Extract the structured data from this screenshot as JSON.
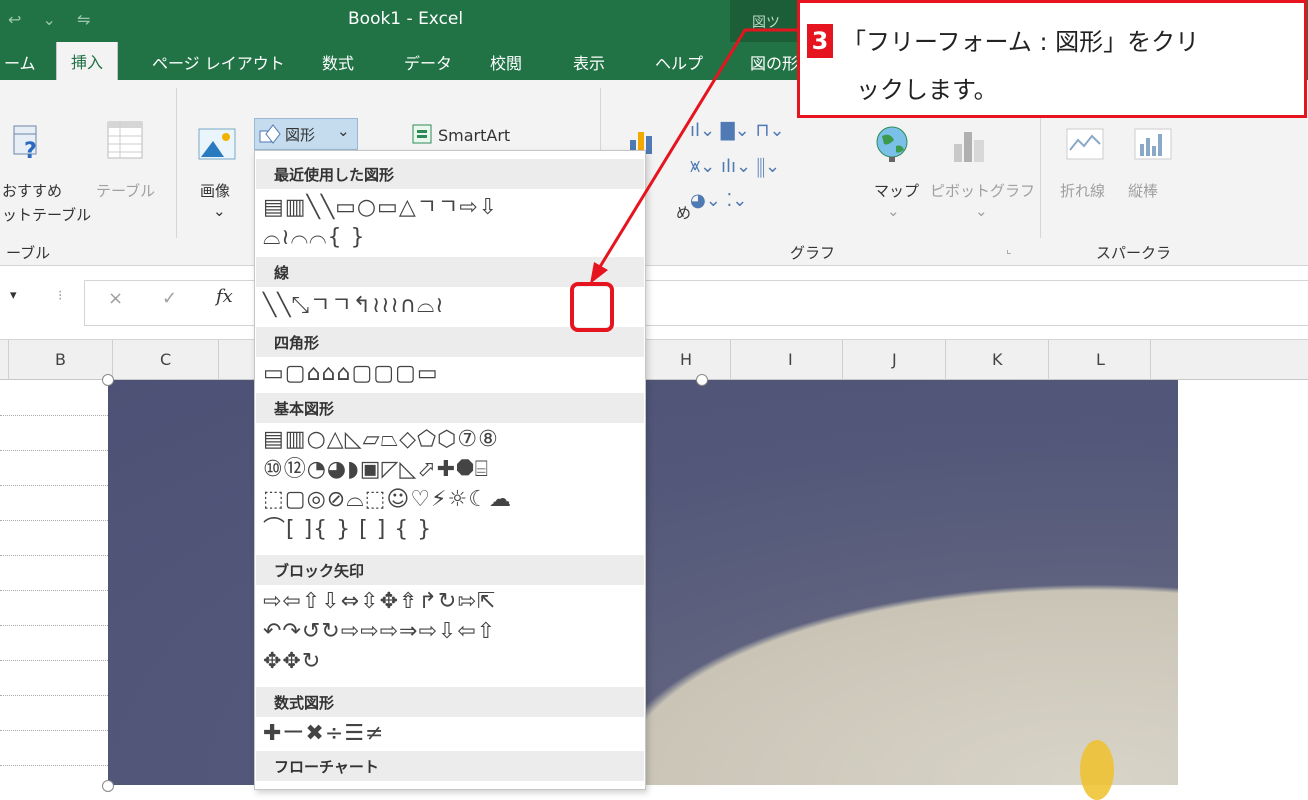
{
  "window": {
    "title": "Book1  -  Excel",
    "quick_access": "↩ ⌄ ⇋",
    "context_tab_group": "図ツ"
  },
  "tabs": [
    {
      "label": "ーム"
    },
    {
      "label": "挿入"
    },
    {
      "label": "ページ レイアウト"
    },
    {
      "label": "数式"
    },
    {
      "label": "データ"
    },
    {
      "label": "校閲"
    },
    {
      "label": "表示"
    },
    {
      "label": "ヘルプ"
    },
    {
      "label": "図の形"
    }
  ],
  "ribbon": {
    "recommended_pivot_1": "おすすめ",
    "recommended_pivot_2": "ットテーブル",
    "table": "テーブル",
    "group_table": "ーブル",
    "image": "画像",
    "shapes_button": "図形",
    "smartart": "SmartArt",
    "map": "マップ",
    "pivot_chart": "ピボットグラフ",
    "group_graph": "グラフ",
    "line_spark": "折れ線",
    "column_spark": "縦棒",
    "group_sparkline": "スパークラ",
    "partial_chart_label": "め"
  },
  "formula_bar": {
    "cancel": "×",
    "enter": "✓",
    "fx": "fx"
  },
  "columns": [
    "B",
    "C",
    "H",
    "I",
    "J",
    "K",
    "L"
  ],
  "dropdown": {
    "sections": [
      {
        "title": "最近使用した図形",
        "rows": [
          "▤▥╲╲▭○▭△ㄱㄱ⇨⇩",
          "⌓≀⌒⌒{ }"
        ]
      },
      {
        "title": "線",
        "rows": [
          "╲╲⤡ㄱㄱ↰≀≀≀∩⌓≀"
        ]
      },
      {
        "title": "四角形",
        "rows": [
          "▭▢⌂⌂⌂▢▢▢▭"
        ]
      },
      {
        "title": "基本図形",
        "rows": [
          "▤▥○△◺▱⏢◇⬠⬡⑦⑧",
          "⑩⑫◔◕◗▣◸◺⬀✚⯃⌸",
          "⬚▢◎⊘⌓⬚☺♡⚡☼☾☁",
          "⌒[ ]{ } [ ] { }"
        ]
      },
      {
        "title": "ブロック矢印",
        "rows": [
          "⇨⇦⇧⇩⇔⇳✥⇮↱↻⇰⇱",
          "↶↷↺↻⇨⇨⇨⇒⇨⇩⇦⇧",
          "✥✥↻"
        ]
      },
      {
        "title": "数式図形",
        "rows": [
          "✚ー✖÷☰≠"
        ]
      },
      {
        "title": "フローチャート",
        "rows": []
      }
    ]
  },
  "callout": {
    "step": "3",
    "line1": "「フリーフォーム : 図形」をクリ",
    "line2": "ックします。"
  },
  "colors": {
    "excel_green": "#217346",
    "callout_red": "#e5141e"
  }
}
